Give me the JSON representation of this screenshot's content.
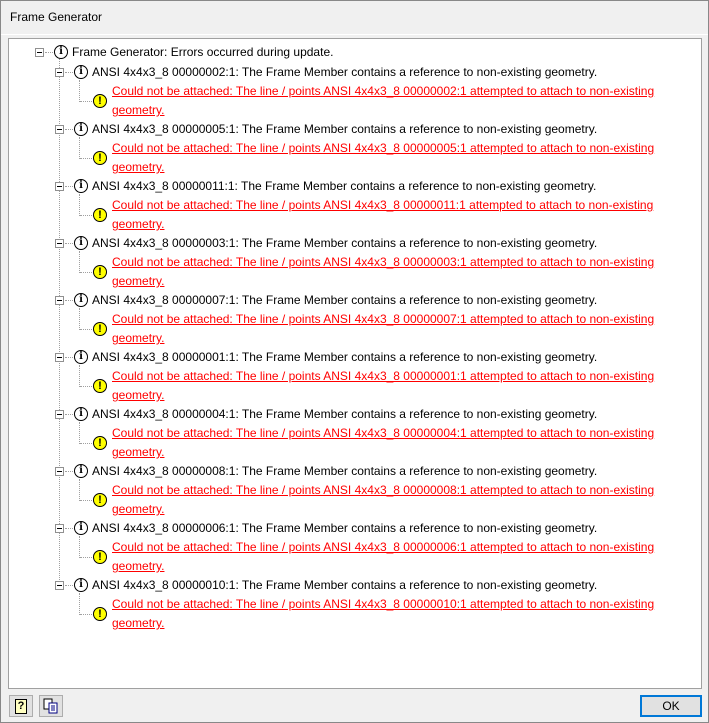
{
  "window": {
    "title": "Frame Generator"
  },
  "tree": {
    "root": {
      "label": "Frame Generator: Errors occurred during update."
    },
    "items": [
      {
        "label": "ANSI 4x4x3_8 00000002:1: The Frame Member contains a reference to non-existing geometry.",
        "error_line1": "Could not be attached: The line / points ANSI 4x4x3_8 00000002:1 attempted to attach to non-existing",
        "error_line2": "geometry."
      },
      {
        "label": "ANSI 4x4x3_8 00000005:1: The Frame Member contains a reference to non-existing geometry.",
        "error_line1": "Could not be attached: The line / points ANSI 4x4x3_8 00000005:1 attempted to attach to non-existing",
        "error_line2": "geometry."
      },
      {
        "label": "ANSI 4x4x3_8 00000011:1: The Frame Member contains a reference to non-existing geometry.",
        "error_line1": "Could not be attached: The line / points ANSI 4x4x3_8 00000011:1 attempted to attach to non-existing",
        "error_line2": "geometry."
      },
      {
        "label": "ANSI 4x4x3_8 00000003:1: The Frame Member contains a reference to non-existing geometry.",
        "error_line1": "Could not be attached: The line / points ANSI 4x4x3_8 00000003:1 attempted to attach to non-existing",
        "error_line2": "geometry."
      },
      {
        "label": "ANSI 4x4x3_8 00000007:1: The Frame Member contains a reference to non-existing geometry.",
        "error_line1": "Could not be attached: The line / points ANSI 4x4x3_8 00000007:1 attempted to attach to non-existing",
        "error_line2": "geometry."
      },
      {
        "label": "ANSI 4x4x3_8 00000001:1: The Frame Member contains a reference to non-existing geometry.",
        "error_line1": "Could not be attached: The line / points ANSI 4x4x3_8 00000001:1 attempted to attach to non-existing",
        "error_line2": "geometry."
      },
      {
        "label": "ANSI 4x4x3_8 00000004:1: The Frame Member contains a reference to non-existing geometry.",
        "error_line1": "Could not be attached: The line / points ANSI 4x4x3_8 00000004:1 attempted to attach to non-existing",
        "error_line2": "geometry."
      },
      {
        "label": "ANSI 4x4x3_8 00000008:1: The Frame Member contains a reference to non-existing geometry.",
        "error_line1": "Could not be attached: The line / points ANSI 4x4x3_8 00000008:1 attempted to attach to non-existing",
        "error_line2": "geometry."
      },
      {
        "label": "ANSI 4x4x3_8 00000006:1: The Frame Member contains a reference to non-existing geometry.",
        "error_line1": "Could not be attached: The line / points ANSI 4x4x3_8 00000006:1 attempted to attach to non-existing",
        "error_line2": "geometry."
      },
      {
        "label": "ANSI 4x4x3_8 00000010:1: The Frame Member contains a reference to non-existing geometry.",
        "error_line1": "Could not be attached: The line / points ANSI 4x4x3_8 00000010:1 attempted to attach to non-existing",
        "error_line2": "geometry."
      }
    ]
  },
  "icons": {
    "info": "i",
    "warning": "!"
  },
  "footer": {
    "ok_label": "OK",
    "help_icon": "?"
  }
}
